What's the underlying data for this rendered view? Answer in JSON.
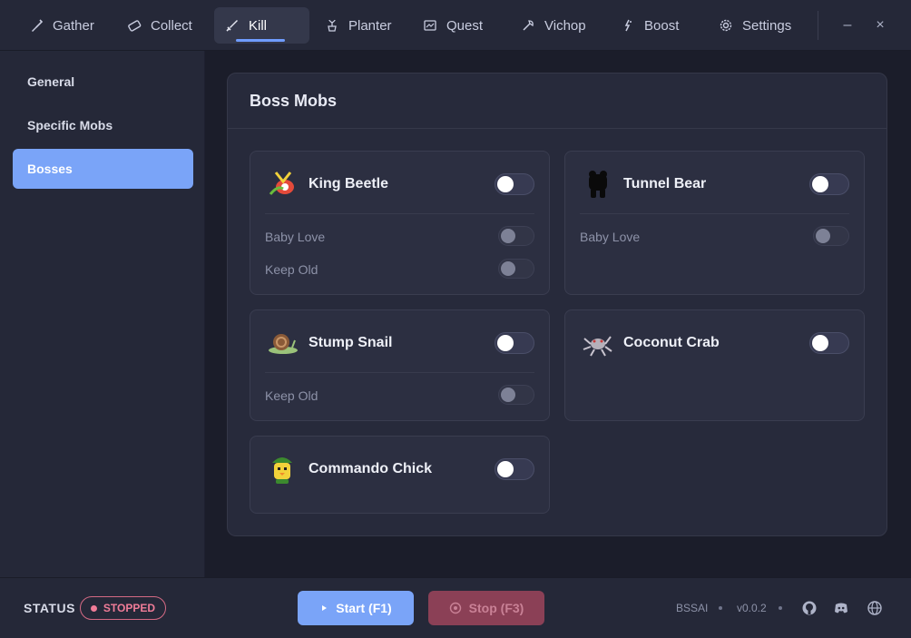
{
  "nav": {
    "tabs": [
      {
        "label": "Gather",
        "icon": "shovel-icon"
      },
      {
        "label": "Collect",
        "icon": "ticket-icon"
      },
      {
        "label": "Kill",
        "icon": "sword-icon",
        "active": true
      },
      {
        "label": "Planter",
        "icon": "planter-icon"
      },
      {
        "label": "Quest",
        "icon": "map-icon"
      },
      {
        "label": "Vichop",
        "icon": "axe-icon"
      },
      {
        "label": "Boost",
        "icon": "boost-icon"
      },
      {
        "label": "Settings",
        "icon": "gear-icon"
      }
    ],
    "window": {
      "minimize": "–",
      "close": "×"
    }
  },
  "sidebar": {
    "items": [
      {
        "label": "General"
      },
      {
        "label": "Specific Mobs"
      },
      {
        "label": "Bosses",
        "active": true
      }
    ]
  },
  "panel": {
    "title": "Boss Mobs",
    "cards": [
      {
        "name": "King Beetle",
        "icon": "king-beetle-icon",
        "enabled": false,
        "options": [
          {
            "label": "Baby Love",
            "enabled": false
          },
          {
            "label": "Keep Old",
            "enabled": false
          }
        ]
      },
      {
        "name": "Tunnel Bear",
        "icon": "tunnel-bear-icon",
        "enabled": false,
        "options": [
          {
            "label": "Baby Love",
            "enabled": false
          }
        ]
      },
      {
        "name": "Stump Snail",
        "icon": "stump-snail-icon",
        "enabled": false,
        "options": [
          {
            "label": "Keep Old",
            "enabled": false
          }
        ]
      },
      {
        "name": "Coconut Crab",
        "icon": "coconut-crab-icon",
        "enabled": false,
        "options": []
      },
      {
        "name": "Commando Chick",
        "icon": "commando-chick-icon",
        "enabled": false,
        "options": []
      }
    ]
  },
  "footer": {
    "status_label": "STATUS",
    "status_value": "STOPPED",
    "start_label": "Start (F1)",
    "stop_label": "Stop (F3)",
    "app_name": "BSSAI",
    "version": "v0.0.2"
  },
  "colors": {
    "accent": "#7aa4f8",
    "stopped": "#f07c98",
    "background": "#1b1d2a",
    "panel": "#272a3b"
  }
}
